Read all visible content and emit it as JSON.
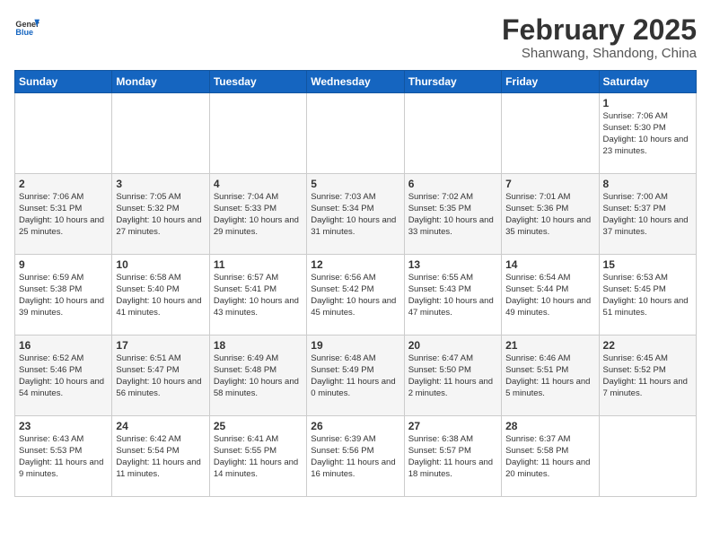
{
  "header": {
    "logo_general": "General",
    "logo_blue": "Blue",
    "month": "February 2025",
    "location": "Shanwang, Shandong, China"
  },
  "days_of_week": [
    "Sunday",
    "Monday",
    "Tuesday",
    "Wednesday",
    "Thursday",
    "Friday",
    "Saturday"
  ],
  "weeks": [
    [
      {
        "day": "",
        "info": ""
      },
      {
        "day": "",
        "info": ""
      },
      {
        "day": "",
        "info": ""
      },
      {
        "day": "",
        "info": ""
      },
      {
        "day": "",
        "info": ""
      },
      {
        "day": "",
        "info": ""
      },
      {
        "day": "1",
        "info": "Sunrise: 7:06 AM\nSunset: 5:30 PM\nDaylight: 10 hours and 23 minutes."
      }
    ],
    [
      {
        "day": "2",
        "info": "Sunrise: 7:06 AM\nSunset: 5:31 PM\nDaylight: 10 hours and 25 minutes."
      },
      {
        "day": "3",
        "info": "Sunrise: 7:05 AM\nSunset: 5:32 PM\nDaylight: 10 hours and 27 minutes."
      },
      {
        "day": "4",
        "info": "Sunrise: 7:04 AM\nSunset: 5:33 PM\nDaylight: 10 hours and 29 minutes."
      },
      {
        "day": "5",
        "info": "Sunrise: 7:03 AM\nSunset: 5:34 PM\nDaylight: 10 hours and 31 minutes."
      },
      {
        "day": "6",
        "info": "Sunrise: 7:02 AM\nSunset: 5:35 PM\nDaylight: 10 hours and 33 minutes."
      },
      {
        "day": "7",
        "info": "Sunrise: 7:01 AM\nSunset: 5:36 PM\nDaylight: 10 hours and 35 minutes."
      },
      {
        "day": "8",
        "info": "Sunrise: 7:00 AM\nSunset: 5:37 PM\nDaylight: 10 hours and 37 minutes."
      }
    ],
    [
      {
        "day": "9",
        "info": "Sunrise: 6:59 AM\nSunset: 5:38 PM\nDaylight: 10 hours and 39 minutes."
      },
      {
        "day": "10",
        "info": "Sunrise: 6:58 AM\nSunset: 5:40 PM\nDaylight: 10 hours and 41 minutes."
      },
      {
        "day": "11",
        "info": "Sunrise: 6:57 AM\nSunset: 5:41 PM\nDaylight: 10 hours and 43 minutes."
      },
      {
        "day": "12",
        "info": "Sunrise: 6:56 AM\nSunset: 5:42 PM\nDaylight: 10 hours and 45 minutes."
      },
      {
        "day": "13",
        "info": "Sunrise: 6:55 AM\nSunset: 5:43 PM\nDaylight: 10 hours and 47 minutes."
      },
      {
        "day": "14",
        "info": "Sunrise: 6:54 AM\nSunset: 5:44 PM\nDaylight: 10 hours and 49 minutes."
      },
      {
        "day": "15",
        "info": "Sunrise: 6:53 AM\nSunset: 5:45 PM\nDaylight: 10 hours and 51 minutes."
      }
    ],
    [
      {
        "day": "16",
        "info": "Sunrise: 6:52 AM\nSunset: 5:46 PM\nDaylight: 10 hours and 54 minutes."
      },
      {
        "day": "17",
        "info": "Sunrise: 6:51 AM\nSunset: 5:47 PM\nDaylight: 10 hours and 56 minutes."
      },
      {
        "day": "18",
        "info": "Sunrise: 6:49 AM\nSunset: 5:48 PM\nDaylight: 10 hours and 58 minutes."
      },
      {
        "day": "19",
        "info": "Sunrise: 6:48 AM\nSunset: 5:49 PM\nDaylight: 11 hours and 0 minutes."
      },
      {
        "day": "20",
        "info": "Sunrise: 6:47 AM\nSunset: 5:50 PM\nDaylight: 11 hours and 2 minutes."
      },
      {
        "day": "21",
        "info": "Sunrise: 6:46 AM\nSunset: 5:51 PM\nDaylight: 11 hours and 5 minutes."
      },
      {
        "day": "22",
        "info": "Sunrise: 6:45 AM\nSunset: 5:52 PM\nDaylight: 11 hours and 7 minutes."
      }
    ],
    [
      {
        "day": "23",
        "info": "Sunrise: 6:43 AM\nSunset: 5:53 PM\nDaylight: 11 hours and 9 minutes."
      },
      {
        "day": "24",
        "info": "Sunrise: 6:42 AM\nSunset: 5:54 PM\nDaylight: 11 hours and 11 minutes."
      },
      {
        "day": "25",
        "info": "Sunrise: 6:41 AM\nSunset: 5:55 PM\nDaylight: 11 hours and 14 minutes."
      },
      {
        "day": "26",
        "info": "Sunrise: 6:39 AM\nSunset: 5:56 PM\nDaylight: 11 hours and 16 minutes."
      },
      {
        "day": "27",
        "info": "Sunrise: 6:38 AM\nSunset: 5:57 PM\nDaylight: 11 hours and 18 minutes."
      },
      {
        "day": "28",
        "info": "Sunrise: 6:37 AM\nSunset: 5:58 PM\nDaylight: 11 hours and 20 minutes."
      },
      {
        "day": "",
        "info": ""
      }
    ]
  ]
}
